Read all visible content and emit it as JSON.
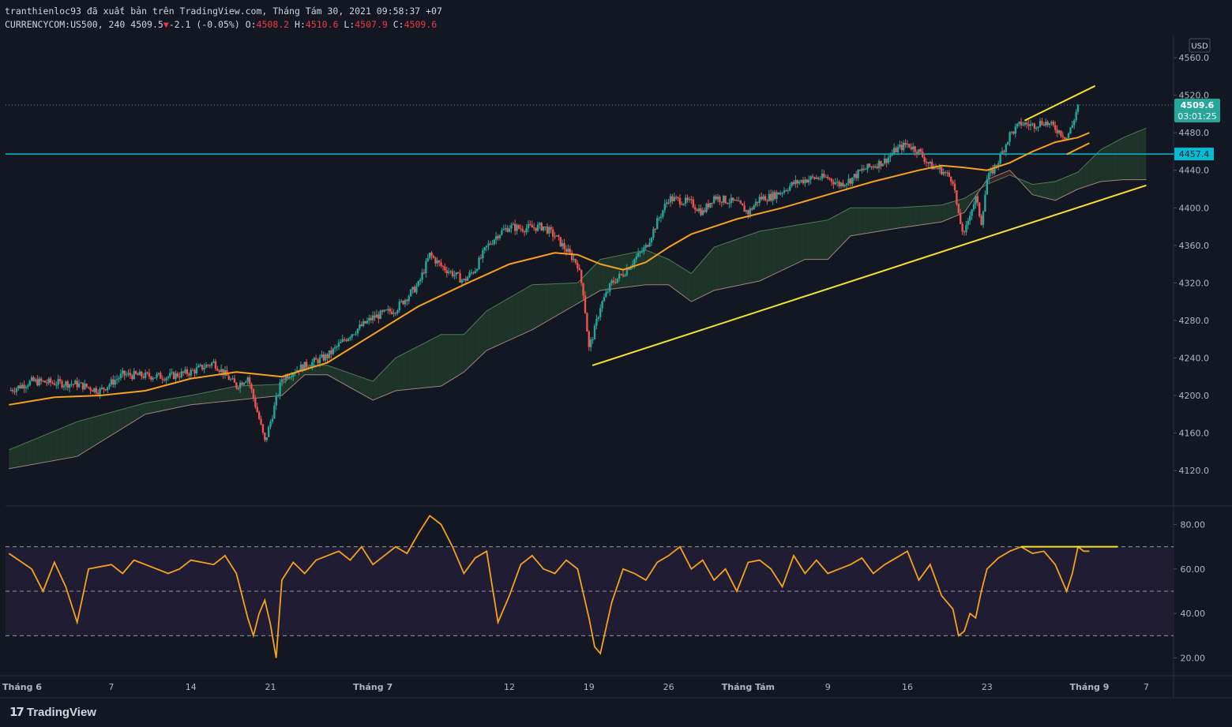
{
  "header": {
    "publisher_line": "tranthienloc93 đã xuất bản trên TradingView.com, Tháng Tám 30, 2021 09:58:37 +07",
    "symbol": "CURRENCYCOM:US500, 240",
    "last": "4509.5",
    "change_arrow": "▼",
    "change": "-2.1 (-0.05%)",
    "o_label": "O:",
    "o_value": "4508.2",
    "h_label": "H:",
    "h_value": "4510.6",
    "l_label": "L:",
    "l_value": "4507.9",
    "c_label": "C:",
    "c_value": "4509.6"
  },
  "footer": {
    "brand": "TradingView"
  },
  "colors": {
    "background": "#131722",
    "up": "#26a69a",
    "down": "#ef5350",
    "ema": "#f7a21b",
    "trendline": "#f5e12f",
    "horizontal_line": "#00bcd4",
    "rsi": "#f7a21b",
    "cloud_bull": "#1e3329",
    "cloud_bear": "#3b2126"
  },
  "chart_data": [
    {
      "type": "candlestick",
      "panel": "price",
      "currency": "USD",
      "y_ticks": [
        4120.0,
        4160.0,
        4200.0,
        4240.0,
        4280.0,
        4320.0,
        4360.0,
        4400.0,
        4440.0,
        4480.0,
        4520.0,
        4560.0
      ],
      "y_tick_labels": [
        "4120.0",
        "4160.0",
        "4200.0",
        "4240.0",
        "4280.0",
        "4320.0",
        "4360.0",
        "4400.0",
        "4440.0",
        "4480.0",
        "4520.0",
        "4560.0"
      ],
      "ylim": [
        4083,
        4582
      ],
      "x_tick_labels": [
        "Tháng 6",
        "7",
        "14",
        "21",
        "Tháng 7",
        "12",
        "19",
        "26",
        "Tháng Tám",
        "9",
        "16",
        "23",
        "Tháng 9",
        "7"
      ],
      "x_tick_days": [
        -2,
        7,
        14,
        21,
        30,
        42,
        49,
        56,
        63,
        70,
        77,
        84,
        93,
        98
      ],
      "x_range_days": [
        -2.3,
        100.4
      ],
      "price_path": [
        [
          -2.0,
          4205
        ],
        [
          0,
          4215
        ],
        [
          4,
          4212
        ],
        [
          6,
          4205
        ],
        [
          8,
          4222
        ],
        [
          12,
          4220
        ],
        [
          14,
          4225
        ],
        [
          16,
          4235
        ],
        [
          18,
          4210
        ],
        [
          19,
          4220
        ],
        [
          20,
          4175
        ],
        [
          20.5,
          4150
        ],
        [
          21,
          4172
        ],
        [
          22,
          4218
        ],
        [
          23,
          4226
        ],
        [
          26,
          4242
        ],
        [
          28,
          4265
        ],
        [
          30,
          4283
        ],
        [
          32,
          4292
        ],
        [
          34,
          4318
        ],
        [
          35,
          4350
        ],
        [
          36,
          4338
        ],
        [
          37,
          4330
        ],
        [
          38,
          4322
        ],
        [
          39,
          4335
        ],
        [
          40,
          4358
        ],
        [
          41,
          4372
        ],
        [
          42,
          4380
        ],
        [
          43,
          4378
        ],
        [
          45,
          4380
        ],
        [
          46,
          4370
        ],
        [
          47,
          4355
        ],
        [
          48,
          4340
        ],
        [
          48.5,
          4310
        ],
        [
          49,
          4250
        ],
        [
          49.5,
          4270
        ],
        [
          50,
          4295
        ],
        [
          51,
          4320
        ],
        [
          52,
          4330
        ],
        [
          53,
          4345
        ],
        [
          54,
          4358
        ],
        [
          55,
          4385
        ],
        [
          56,
          4410
        ],
        [
          57,
          4408
        ],
        [
          58,
          4405
        ],
        [
          59,
          4395
        ],
        [
          60,
          4412
        ],
        [
          61,
          4408
        ],
        [
          62,
          4405
        ],
        [
          63,
          4395
        ],
        [
          64,
          4410
        ],
        [
          65,
          4412
        ],
        [
          66,
          4418
        ],
        [
          67,
          4426
        ],
        [
          68,
          4430
        ],
        [
          69,
          4432
        ],
        [
          70,
          4432
        ],
        [
          71,
          4425
        ],
        [
          72,
          4430
        ],
        [
          73,
          4440
        ],
        [
          74,
          4445
        ],
        [
          75,
          4450
        ],
        [
          76,
          4462
        ],
        [
          77,
          4468
        ],
        [
          78,
          4460
        ],
        [
          79,
          4445
        ],
        [
          80,
          4440
        ],
        [
          81,
          4430
        ],
        [
          81.5,
          4390
        ],
        [
          82,
          4370
        ],
        [
          82.5,
          4395
        ],
        [
          83,
          4410
        ],
        [
          83.5,
          4385
        ],
        [
          84,
          4430
        ],
        [
          85,
          4450
        ],
        [
          86,
          4478
        ],
        [
          87,
          4490
        ],
        [
          88,
          4488
        ],
        [
          89,
          4492
        ],
        [
          90,
          4485
        ],
        [
          91,
          4475
        ],
        [
          91.5,
          4488
        ],
        [
          92,
          4509.6
        ]
      ],
      "ema": [
        [
          -2.0,
          4190
        ],
        [
          2,
          4198
        ],
        [
          6,
          4200
        ],
        [
          10,
          4205
        ],
        [
          14,
          4218
        ],
        [
          18,
          4225
        ],
        [
          22,
          4220
        ],
        [
          26,
          4235
        ],
        [
          30,
          4265
        ],
        [
          34,
          4295
        ],
        [
          38,
          4318
        ],
        [
          42,
          4340
        ],
        [
          46,
          4352
        ],
        [
          48,
          4350
        ],
        [
          50,
          4340
        ],
        [
          52,
          4334
        ],
        [
          54,
          4342
        ],
        [
          56,
          4358
        ],
        [
          58,
          4372
        ],
        [
          60,
          4380
        ],
        [
          62,
          4388
        ],
        [
          66,
          4400
        ],
        [
          70,
          4414
        ],
        [
          74,
          4428
        ],
        [
          78,
          4440
        ],
        [
          80,
          4445
        ],
        [
          82,
          4443
        ],
        [
          84,
          4440
        ],
        [
          86,
          4448
        ],
        [
          88,
          4460
        ],
        [
          90,
          4470
        ],
        [
          92,
          4475
        ],
        [
          93,
          4480
        ]
      ],
      "ichimoku": {
        "span_a": [
          [
            -2.0,
            4142
          ],
          [
            4,
            4172
          ],
          [
            10,
            4192
          ],
          [
            14,
            4200
          ],
          [
            18,
            4210
          ],
          [
            22,
            4212
          ],
          [
            24,
            4232
          ],
          [
            26,
            4232
          ],
          [
            30,
            4215
          ],
          [
            32,
            4240
          ],
          [
            36,
            4265
          ],
          [
            38,
            4265
          ],
          [
            40,
            4290
          ],
          [
            44,
            4318
          ],
          [
            48,
            4320
          ],
          [
            50,
            4345
          ],
          [
            54,
            4355
          ],
          [
            56,
            4345
          ],
          [
            58,
            4330
          ],
          [
            60,
            4358
          ],
          [
            64,
            4375
          ],
          [
            68,
            4383
          ],
          [
            70,
            4387
          ],
          [
            72,
            4400
          ],
          [
            76,
            4400
          ],
          [
            80,
            4403
          ],
          [
            82,
            4410
          ],
          [
            84,
            4425
          ],
          [
            86,
            4435
          ],
          [
            88,
            4425
          ],
          [
            90,
            4428
          ],
          [
            92,
            4438
          ],
          [
            94,
            4462
          ],
          [
            96,
            4475
          ],
          [
            98,
            4485
          ]
        ],
        "span_b": [
          [
            -2.0,
            4122
          ],
          [
            4,
            4135
          ],
          [
            10,
            4180
          ],
          [
            14,
            4190
          ],
          [
            18,
            4195
          ],
          [
            22,
            4200
          ],
          [
            24,
            4222
          ],
          [
            26,
            4222
          ],
          [
            30,
            4195
          ],
          [
            32,
            4205
          ],
          [
            36,
            4210
          ],
          [
            38,
            4225
          ],
          [
            40,
            4248
          ],
          [
            44,
            4270
          ],
          [
            48,
            4298
          ],
          [
            50,
            4312
          ],
          [
            54,
            4318
          ],
          [
            56,
            4318
          ],
          [
            58,
            4300
          ],
          [
            60,
            4312
          ],
          [
            64,
            4322
          ],
          [
            68,
            4345
          ],
          [
            70,
            4345
          ],
          [
            72,
            4370
          ],
          [
            76,
            4378
          ],
          [
            80,
            4385
          ],
          [
            82,
            4395
          ],
          [
            84,
            4430
          ],
          [
            86,
            4440
          ],
          [
            88,
            4414
          ],
          [
            90,
            4408
          ],
          [
            92,
            4420
          ],
          [
            94,
            4428
          ],
          [
            96,
            4430
          ],
          [
            98,
            4430
          ]
        ]
      },
      "horizontal_level": 4457.4,
      "horizontal_level_label": "4457.4",
      "last_price_label": "4509.6",
      "countdown": "03:01:25",
      "trendlines": [
        {
          "from": [
            49.3,
            4232
          ],
          "to": [
            98.0,
            4424
          ]
        },
        {
          "from": [
            87.3,
            4493
          ],
          "to": [
            93.5,
            4530
          ]
        },
        {
          "from": [
            91.0,
            4457
          ],
          "to": [
            93.0,
            4469
          ]
        }
      ]
    },
    {
      "type": "line",
      "panel": "rsi",
      "y_ticks": [
        20.0,
        40.0,
        60.0,
        80.0
      ],
      "y_tick_labels": [
        "20.00",
        "40.00",
        "60.00",
        "80.00"
      ],
      "ylim": [
        12,
        88
      ],
      "band_upper": 70,
      "band_mid": 50,
      "band_lower": 30,
      "series": [
        {
          "values": [
            [
              -2.0,
              67
            ],
            [
              0,
              60
            ],
            [
              1,
              50
            ],
            [
              2,
              63
            ],
            [
              3,
              52
            ],
            [
              4,
              36
            ],
            [
              5,
              60
            ],
            [
              7,
              62
            ],
            [
              8,
              58
            ],
            [
              9,
              64
            ],
            [
              11,
              60
            ],
            [
              12,
              58
            ],
            [
              13,
              60
            ],
            [
              14,
              64
            ],
            [
              16,
              62
            ],
            [
              17,
              66
            ],
            [
              18,
              58
            ],
            [
              19,
              38
            ],
            [
              19.5,
              30
            ],
            [
              20,
              40
            ],
            [
              20.5,
              46
            ],
            [
              21,
              35
            ],
            [
              21.5,
              20
            ],
            [
              22,
              55
            ],
            [
              23,
              63
            ],
            [
              24,
              58
            ],
            [
              25,
              64
            ],
            [
              26,
              66
            ],
            [
              27,
              68
            ],
            [
              28,
              64
            ],
            [
              29,
              70
            ],
            [
              30,
              62
            ],
            [
              31,
              66
            ],
            [
              32,
              70
            ],
            [
              33,
              67
            ],
            [
              34,
              76
            ],
            [
              35,
              84
            ],
            [
              36,
              80
            ],
            [
              37,
              70
            ],
            [
              38,
              58
            ],
            [
              39,
              65
            ],
            [
              40,
              68
            ],
            [
              41,
              36
            ],
            [
              42,
              48
            ],
            [
              43,
              62
            ],
            [
              44,
              66
            ],
            [
              45,
              60
            ],
            [
              46,
              58
            ],
            [
              47,
              64
            ],
            [
              48,
              60
            ],
            [
              49,
              38
            ],
            [
              49.5,
              25
            ],
            [
              50,
              22
            ],
            [
              51,
              45
            ],
            [
              52,
              60
            ],
            [
              53,
              58
            ],
            [
              54,
              55
            ],
            [
              55,
              63
            ],
            [
              56,
              66
            ],
            [
              57,
              70
            ],
            [
              58,
              60
            ],
            [
              59,
              64
            ],
            [
              60,
              55
            ],
            [
              61,
              60
            ],
            [
              62,
              50
            ],
            [
              63,
              63
            ],
            [
              64,
              64
            ],
            [
              65,
              60
            ],
            [
              66,
              52
            ],
            [
              67,
              66
            ],
            [
              68,
              58
            ],
            [
              69,
              64
            ],
            [
              70,
              58
            ],
            [
              71,
              60
            ],
            [
              72,
              62
            ],
            [
              73,
              65
            ],
            [
              74,
              58
            ],
            [
              75,
              62
            ],
            [
              76,
              65
            ],
            [
              77,
              68
            ],
            [
              78,
              55
            ],
            [
              79,
              62
            ],
            [
              80,
              48
            ],
            [
              81,
              42
            ],
            [
              81.5,
              30
            ],
            [
              82,
              32
            ],
            [
              82.5,
              40
            ],
            [
              83,
              38
            ],
            [
              83.5,
              50
            ],
            [
              84,
              60
            ],
            [
              85,
              65
            ],
            [
              86,
              68
            ],
            [
              87,
              70
            ],
            [
              88,
              67
            ],
            [
              89,
              68
            ],
            [
              90,
              62
            ],
            [
              91,
              50
            ],
            [
              91.5,
              58
            ],
            [
              92,
              70
            ],
            [
              92.5,
              68
            ],
            [
              93,
              68
            ]
          ]
        }
      ],
      "trendline": {
        "from": [
          87.0,
          70.0
        ],
        "to": [
          95.5,
          70.0
        ]
      }
    }
  ]
}
